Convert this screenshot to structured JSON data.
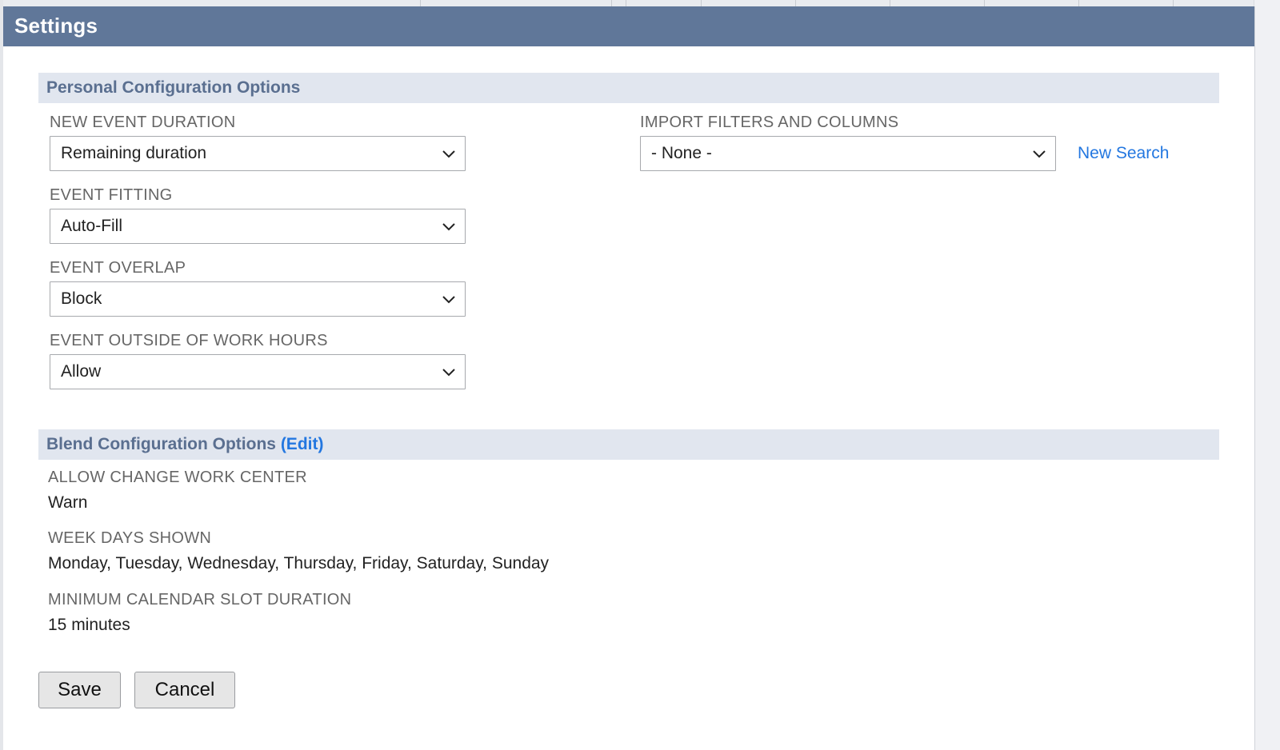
{
  "dialog": {
    "title": "Settings"
  },
  "personal_section": {
    "title": "Personal Configuration Options",
    "fields": {
      "new_event_duration": {
        "label": "NEW EVENT DURATION",
        "value": "Remaining duration"
      },
      "event_fitting": {
        "label": "EVENT FITTING",
        "value": "Auto-Fill"
      },
      "event_overlap": {
        "label": "EVENT OVERLAP",
        "value": "Block"
      },
      "event_outside_work_hours": {
        "label": "EVENT OUTSIDE OF WORK HOURS",
        "value": "Allow"
      },
      "import_filters": {
        "label": "IMPORT FILTERS AND COLUMNS",
        "value": "- None -"
      }
    },
    "new_search_link": "New Search"
  },
  "blend_section": {
    "title": "Blend Configuration Options",
    "edit_link": "(Edit)",
    "fields": {
      "allow_change_work_center": {
        "label": "ALLOW CHANGE WORK CENTER",
        "value": "Warn"
      },
      "week_days_shown": {
        "label": "WEEK DAYS SHOWN",
        "value": "Monday, Tuesday, Wednesday, Thursday, Friday, Saturday, Sunday"
      },
      "min_slot_duration": {
        "label": "MINIMUM CALENDAR SLOT DURATION",
        "value": "15 minutes"
      }
    }
  },
  "buttons": {
    "save": "Save",
    "cancel": "Cancel"
  },
  "colors": {
    "header_bg": "#607799",
    "section_bg": "#e1e6ef",
    "section_text": "#5a6f90",
    "link": "#2377e0"
  },
  "icons": {
    "dropdown": "chevron-down-icon"
  }
}
